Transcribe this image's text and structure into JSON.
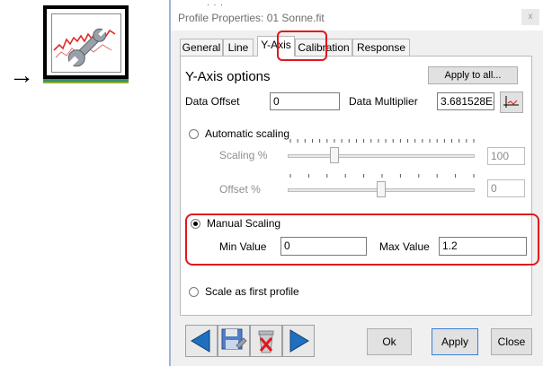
{
  "callout": {
    "arrow": "→",
    "icon": "profile-tools-icon"
  },
  "dialog": {
    "title": "Profile Properties: 01 Sonne.fit",
    "close": "x",
    "tabs": [
      {
        "label": "General",
        "active": false
      },
      {
        "label": "Line",
        "active": false
      },
      {
        "label": "Y-Axis",
        "active": true
      },
      {
        "label": "Calibration",
        "active": false
      },
      {
        "label": "Response",
        "active": false
      }
    ],
    "section_title": "Y-Axis options",
    "apply_to_all": "Apply to all...",
    "data_offset_label": "Data Offset",
    "data_offset_value": "0",
    "data_multiplier_label": "Data Multiplier",
    "data_multiplier_value": "3.681528E-",
    "auto_scaling_label": "Automatic scaling",
    "scaling_label": "Scaling %",
    "scaling_value": "100",
    "scaling_slider_fraction": 0.25,
    "offset_label": "Offset %",
    "offset_value": "0",
    "offset_slider_fraction": 0.5,
    "manual_scaling_label": "Manual Scaling",
    "min_value_label": "Min Value",
    "min_value": "0",
    "max_value_label": "Max Value",
    "max_value": "1.2",
    "scale_first_label": "Scale as first profile",
    "selected_mode": "manual",
    "buttons": {
      "ok": "Ok",
      "apply": "Apply",
      "close": "Close"
    },
    "colors": {
      "highlight": "#e0161e",
      "nav_arrow": "#1f6fbf"
    }
  }
}
